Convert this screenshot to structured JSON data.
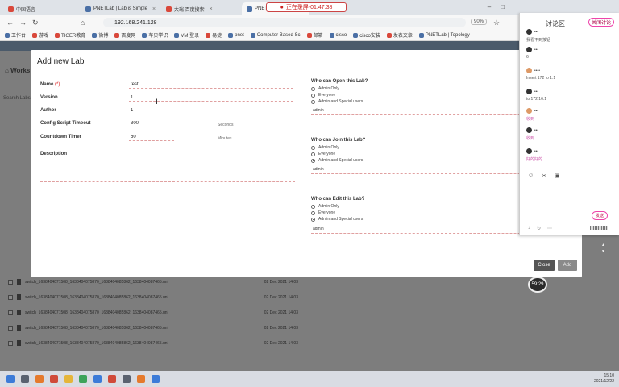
{
  "browser": {
    "tabs": [
      {
        "title": "中国语言"
      },
      {
        "title": "PNETLab | Lab is Simple"
      },
      {
        "title": "大瑞 百度搜索"
      },
      {
        "title": "PNETLab"
      }
    ],
    "recording": "正在录屏-01:47:38",
    "address": "192.168.241.128",
    "zoom": "90%",
    "bookmarks": [
      "工作台",
      "游戏",
      "TIGER教育",
      "微博",
      "百度网",
      "芊贝学识",
      "VM 登录",
      "易捷",
      "pnet",
      "Computer Based Sc",
      "邮箱",
      "cisco",
      "cisco安装",
      "发表文章",
      "PNETLab | Topology"
    ]
  },
  "background_app": {
    "title": "Works",
    "search": "Search Labs",
    "rows": [
      {
        "name": "switch_1638404071508_1638404075870_1638404085862_1638404087465.unl",
        "date": "02 Dec 2021 14:03"
      },
      {
        "name": "switch_1638404071508_1638404075870_1638404085862_1638404087465.unl",
        "date": "02 Dec 2021 14:03"
      },
      {
        "name": "switch_1638404071508_1638404075870_1638404085862_1638404087465.unl",
        "date": "02 Dec 2021 14:03"
      },
      {
        "name": "switch_1638404071508_1638404075870_1638404085862_1638404087465.unl",
        "date": "02 Dec 2021 14:03"
      },
      {
        "name": "switch_1638404071508_1638404075870_1638404085862_1638404087465.unl",
        "date": "02 Dec 2021 14:03"
      }
    ]
  },
  "modal": {
    "title": "Add new Lab",
    "fields": {
      "name_label": "Name",
      "name_req": "(*)",
      "name_value": "test",
      "version_label": "Version",
      "version_value": "1",
      "author_label": "Author",
      "author_value": "1",
      "timeout_label": "Config Script Timeout",
      "timeout_value": "300",
      "timeout_unit": "Seconds",
      "countdown_label": "Countdown Timer",
      "countdown_value": "60",
      "countdown_unit": "Minutes",
      "description_label": "Description"
    },
    "open_section": {
      "title": "Who can Open this Lab?",
      "options": [
        "Admin Only",
        "Everyone",
        "Admin and Special users"
      ],
      "tag": "admin"
    },
    "join_section": {
      "title": "Who can Join this Lab?",
      "options": [
        "Admin Only",
        "Everyone",
        "Admin and Special users"
      ],
      "tag": "admin"
    },
    "edit_section": {
      "title": "Who can Edit this Lab?",
      "options": [
        "Admin Only",
        "Everyone",
        "Admin and Special users"
      ],
      "tag": "admin"
    },
    "close_label": "Close",
    "add_label": "Add"
  },
  "discussion": {
    "title": "讨论区",
    "close": "关闭讨论",
    "messages": [
      {
        "user": "•••",
        "text": "我看不到按钮"
      },
      {
        "user": "•••",
        "text": "6"
      },
      {
        "user": "••••",
        "text": "Insert 172 to 1.1"
      },
      {
        "user": "•••",
        "text": "to 172.16.1"
      },
      {
        "user": "•••",
        "text": "收到"
      },
      {
        "user": "•••",
        "text": "收到"
      },
      {
        "user": "•••",
        "text": "好的好的"
      }
    ],
    "send": "发送"
  },
  "timer": "59:29",
  "clock": {
    "time": "15:10",
    "date": "2021/12/22"
  }
}
